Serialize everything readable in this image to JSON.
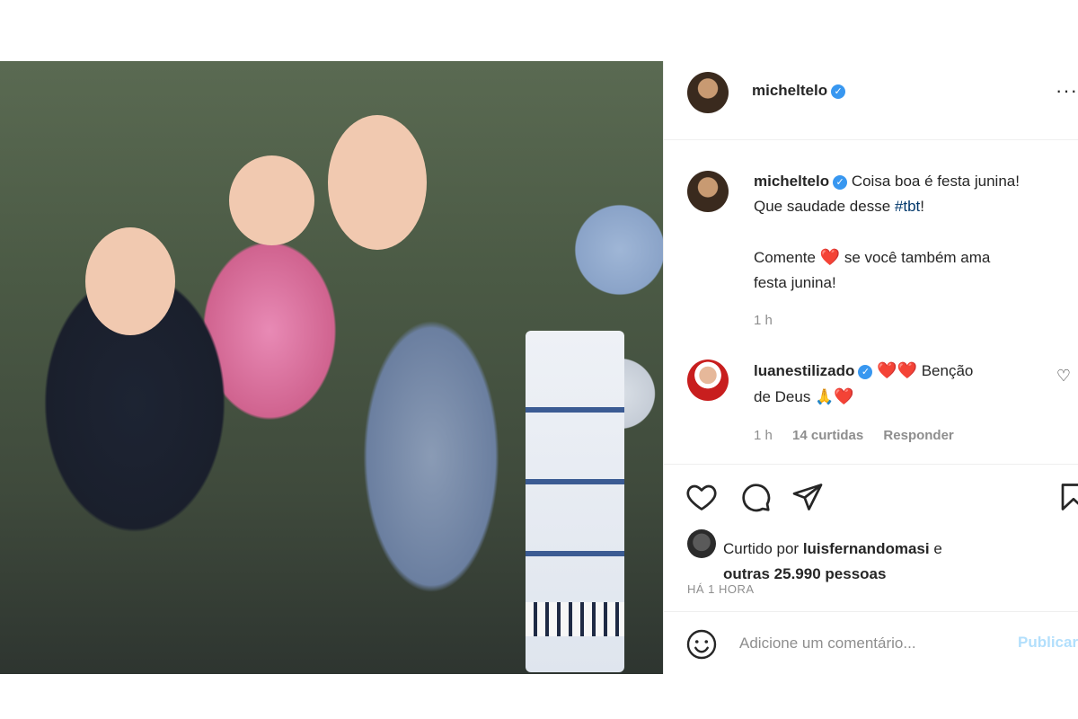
{
  "post": {
    "username": "micheltelo",
    "more_label": "···",
    "caption": {
      "username": "micheltelo",
      "line1": "Coisa boa é festa junina!",
      "line2_prefix": "Que saudade desse ",
      "hashtag": "#tbt",
      "line2_suffix": "!",
      "line3_prefix": "Comente ",
      "heart": "❤️",
      "line3_suffix": " se você também ama",
      "line4": "festa junina!",
      "time": "1 h"
    },
    "comment": {
      "username": "luanestilizado",
      "hearts": "❤️❤️",
      "text1": " Benção",
      "text2": "de Deus ",
      "pray": "🙏",
      "heart_end": "❤️",
      "time": "1 h",
      "likes": "14 curtidas",
      "reply": "Responder"
    },
    "actions": {
      "liked_by_prefix": "Curtido por ",
      "liked_by_user": "luisfernandomasi",
      "liked_by_mid": " e",
      "others": "outras 25.990 pessoas",
      "time_ago": "HÁ 1 HORA"
    },
    "add_comment": {
      "placeholder": "Adicione um comentário...",
      "publish": "Publicar"
    }
  },
  "icons": {
    "heart": "heart-icon",
    "comment": "comment-icon",
    "share": "share-icon",
    "save": "bookmark-icon",
    "emoji": "emoji-icon",
    "verified": "verified-badge-icon"
  },
  "colors": {
    "verified": "#3897f0",
    "hashtag": "#00376b",
    "muted": "#8e8e8e",
    "publish": "#b2dffc",
    "heart": "#e0241b"
  }
}
